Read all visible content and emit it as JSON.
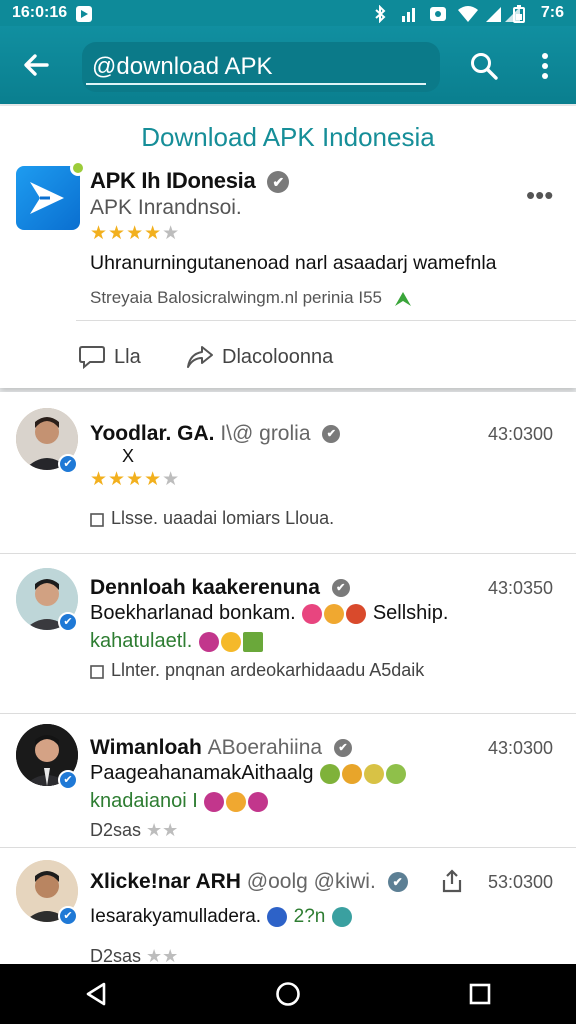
{
  "status_bar": {
    "time": "16:0:16",
    "battery_text": "7:6"
  },
  "toolbar": {
    "search_value": "@download APK"
  },
  "featured": {
    "heading": "Download APK Indonesia",
    "app_name": "APK Ih IDonesia",
    "app_subtitle": "APK Inrandnsoi.",
    "rating": 4,
    "description": "Uhranurningutanenoad narl asaadarj  wamefnla",
    "meta": "Streyaia Balosicralwingm.nl perinia I55",
    "actions": [
      {
        "label": "Lla"
      },
      {
        "label": "Dlacoloonna"
      }
    ]
  },
  "posts": [
    {
      "name": "Yoodlar. GA.",
      "handle": "I\\@ grolia",
      "time": "43:0300",
      "extra": "X",
      "rating": 4,
      "line1": "",
      "line2": "",
      "meta": "Llsse.  uaadai lomiars Lloua."
    },
    {
      "name": "Dennloah kaakerenuna",
      "handle": "",
      "time": "43:0350",
      "rating": 0,
      "line1": "Boekharlanad bonkam.",
      "line1_tail": "Sellship.",
      "line2": "kahatulaetl.",
      "meta": "Llnter.  pnqnan ardeokarhidaadu A5daik"
    },
    {
      "name": "Wimanloah",
      "handle": "ABoerahiina",
      "time": "43:0300",
      "rating": 0,
      "line1": "PaageahanamakAithaalg",
      "line2": "knadaianoi I",
      "meta": "D2sas"
    },
    {
      "name": "Xlicke!nar ARH",
      "handle": "@oolg @kiwi.",
      "time": "53:0300",
      "rating": 0,
      "line1": "Iesarakyamulladera.",
      "line1_tail": "2?n",
      "line2": "",
      "meta": "D2sas"
    }
  ],
  "colors": {
    "appbar": "#0e8a99",
    "heading": "#168e98",
    "star": "#f2b01e",
    "verified": "#1f79d6"
  }
}
